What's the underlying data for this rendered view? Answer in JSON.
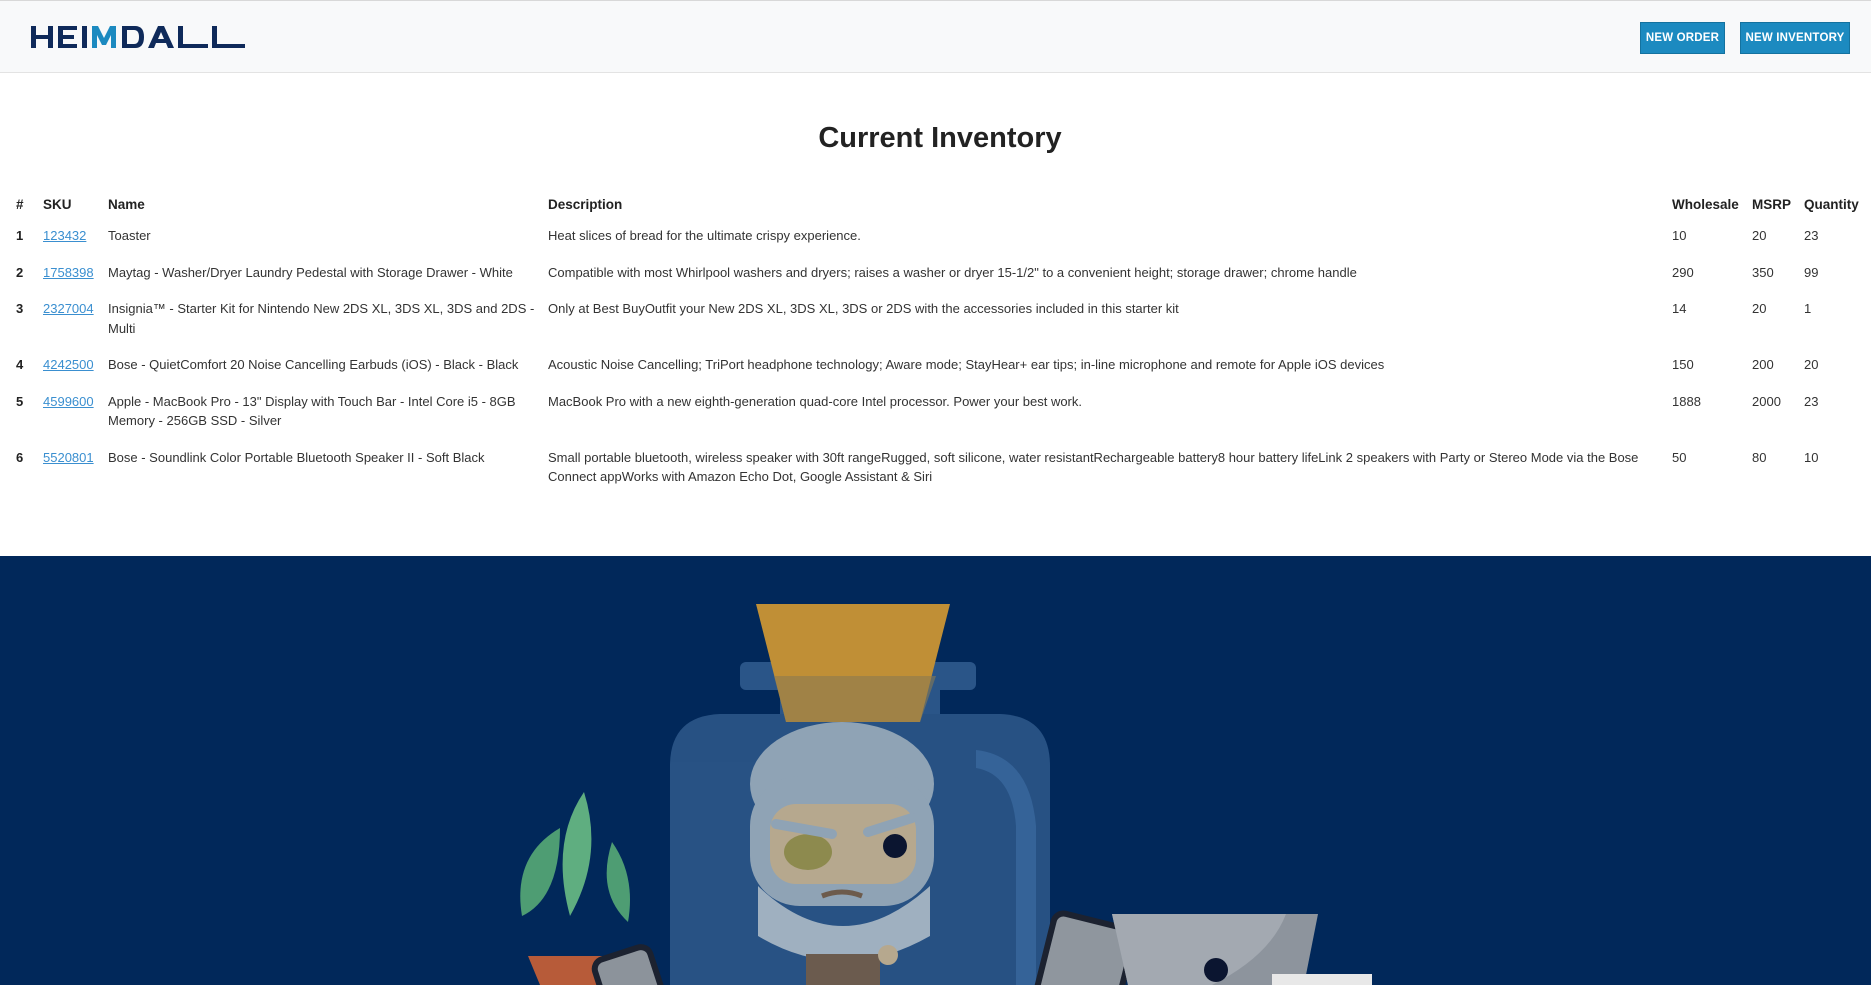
{
  "header": {
    "logo_text": "HEIMDALL",
    "new_order_label": "NEW ORDER",
    "new_inventory_label": "NEW INVENTORY"
  },
  "page": {
    "title": "Current Inventory"
  },
  "table": {
    "columns": [
      "#",
      "SKU",
      "Name",
      "Description",
      "Wholesale",
      "MSRP",
      "Quantity"
    ],
    "rows": [
      {
        "index": "1",
        "sku": "123432",
        "name": "Toaster",
        "description": "Heat slices of bread for the ultimate crispy experience.",
        "wholesale": "10",
        "msrp": "20",
        "quantity": "23"
      },
      {
        "index": "2",
        "sku": "1758398",
        "name": "Maytag - Washer/Dryer Laundry Pedestal with Storage Drawer - White",
        "description": "Compatible with most Whirlpool washers and dryers; raises a washer or dryer 15-1/2\" to a convenient height; storage drawer; chrome handle",
        "wholesale": "290",
        "msrp": "350",
        "quantity": "99"
      },
      {
        "index": "3",
        "sku": "2327004",
        "name": "Insignia™ - Starter Kit for Nintendo New 2DS XL, 3DS XL, 3DS and 2DS - Multi",
        "description": "Only at Best BuyOutfit your New 2DS XL, 3DS XL, 3DS or 2DS with the accessories included in this starter kit",
        "wholesale": "14",
        "msrp": "20",
        "quantity": "1"
      },
      {
        "index": "4",
        "sku": "4242500",
        "name": "Bose - QuietComfort 20 Noise Cancelling Earbuds (iOS) - Black - Black",
        "description": "Acoustic Noise Cancelling; TriPort headphone technology; Aware mode; StayHear+ ear tips; in-line microphone and remote for Apple iOS devices",
        "wholesale": "150",
        "msrp": "200",
        "quantity": "20"
      },
      {
        "index": "5",
        "sku": "4599600",
        "name": "Apple - MacBook Pro - 13\" Display with Touch Bar - Intel Core i5 - 8GB Memory - 256GB SSD - Silver",
        "description": "MacBook Pro with a new eighth-generation quad-core Intel processor. Power your best work.",
        "wholesale": "1888",
        "msrp": "2000",
        "quantity": "23"
      },
      {
        "index": "6",
        "sku": "5520801",
        "name": "Bose - Soundlink Color Portable Bluetooth Speaker II - Soft Black",
        "description": "Small portable bluetooth, wireless speaker with 30ft rangeRugged, soft silicone, water resistantRechargeable battery8 hour battery lifeLink 2 speakers with Party or Stereo Mode via the Bose Connect appWorks with Amazon Echo Dot, Google Assistant & Siri",
        "wholesale": "50",
        "msrp": "80",
        "quantity": "10"
      }
    ]
  },
  "colors": {
    "brand_navy": "#0f2a5a",
    "brand_blue": "#1c8ac0",
    "hero_background": "#01285a",
    "link": "#3a8fd0"
  }
}
